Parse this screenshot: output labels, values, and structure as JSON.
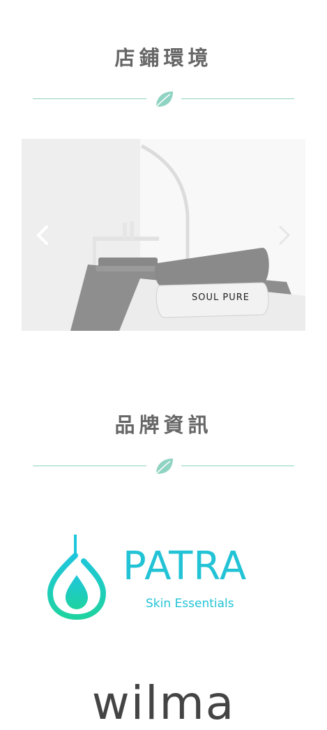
{
  "sections": {
    "store": {
      "title": "店鋪環境"
    },
    "brands": {
      "title": "品牌資訊"
    }
  },
  "carousel": {
    "towel_label": "SOUL PURE",
    "prev_icon": "chevron-left-icon",
    "next_icon": "chevron-right-icon"
  },
  "brands": {
    "patra": {
      "name": "PATRA",
      "tagline": "Skin Essentials"
    },
    "wilma": {
      "name": "wilma"
    }
  },
  "colors": {
    "accent": "#8fd3c2",
    "title": "#666666",
    "patra_brand": "#23c3d6"
  }
}
